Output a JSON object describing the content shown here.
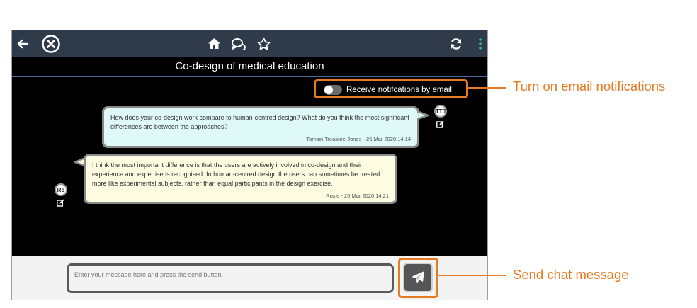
{
  "header": {
    "title": "Co-design of medical education"
  },
  "notifications": {
    "toggle_label": "Receive notifcations by email",
    "enabled": false
  },
  "messages": [
    {
      "avatar": "TTJ",
      "text": "How does your co-design work compare to human-centred design? What do you think the most significant differences are between the approaches?",
      "meta": "Tamsin Treasure-Jones - 26 Mar 2020 14:14"
    },
    {
      "avatar": "Ro",
      "text": "I think the most important difference is that the users are actively involved in co-design and their experience and expertise is recognised. In human-centred design the users can sometimes be treated more like experimental subjects, rather than equal participants in the design exercise.",
      "meta": "Rosie - 26 Mar 2020 14:21"
    }
  ],
  "composer": {
    "placeholder": "Enter your message here and press the send button."
  },
  "callouts": {
    "notifications": "Turn on email notifications",
    "send": "Send chat message"
  },
  "icons": {
    "back": "arrow-left-icon",
    "close": "close-circle-icon",
    "home": "home-icon",
    "chat": "chat-bubbles-icon",
    "favourite": "star-icon",
    "refresh": "refresh-icon",
    "menu": "vertical-dots-icon",
    "edit": "edit-icon",
    "send": "paper-plane-icon"
  },
  "colors": {
    "accent": "#e87a22",
    "topbar": "#2f3b4a",
    "bubble_a": "#dff8f8",
    "bubble_b": "#fdfbe0",
    "menu_dots": "#2ec27e"
  }
}
